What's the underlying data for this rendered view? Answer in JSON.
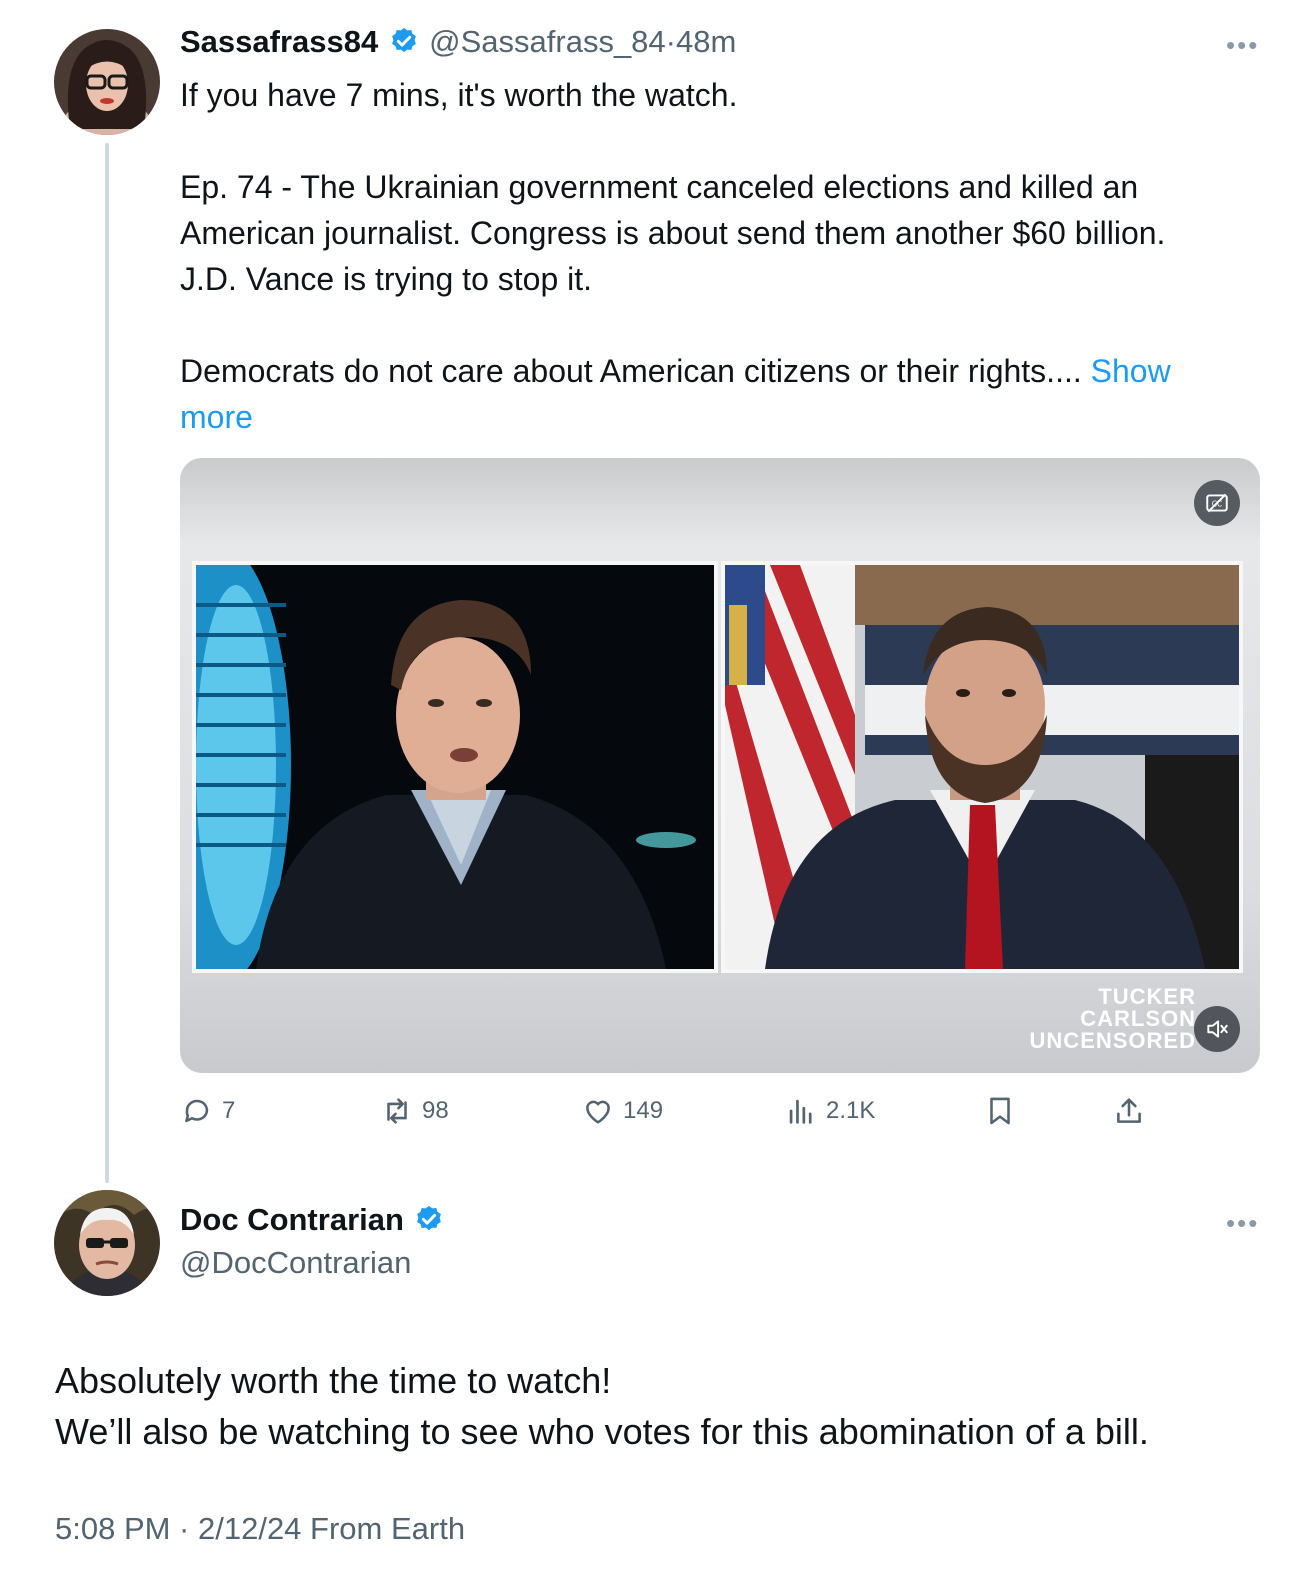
{
  "original_tweet": {
    "display_name": "Sassafrass84",
    "handle": "@Sassafrass_84",
    "separator": "·",
    "time_ago": "48m",
    "verified": true,
    "text_line1": "If you have 7 mins, it's worth the watch.",
    "text_para2_line1": "Ep. 74 - The Ukrainian government canceled elections and killed an",
    "text_para2_line2": "American journalist. Congress is about send them another $60 billion.",
    "text_para2_line3": "J.D. Vance is trying to stop it.",
    "text_para3": "Democrats do not care about American citizens or their rights....",
    "show_more_1": "Show",
    "show_more_2": "more",
    "video": {
      "watermark_line1": "TUCKER",
      "watermark_line2": "CARLSON",
      "watermark_line3": "UNCENSORED",
      "captions_icon": "captions-off-icon",
      "mute_icon": "muted-speaker-icon"
    },
    "actions": {
      "replies": "7",
      "reposts": "98",
      "likes": "149",
      "views": "2.1K"
    }
  },
  "reply_tweet": {
    "display_name": "Doc Contrarian",
    "handle": "@DocContrarian",
    "verified": true,
    "text_line1": "Absolutely worth the time to watch!",
    "text_line2": "We’ll also be watching to see who votes for this abomination of a bill.",
    "timestamp": "5:08 PM · 2/12/24 From Earth"
  },
  "colors": {
    "accent": "#1d9bf0",
    "muted": "#536471",
    "text": "#0f1419",
    "thread_line": "#cfd9de"
  }
}
